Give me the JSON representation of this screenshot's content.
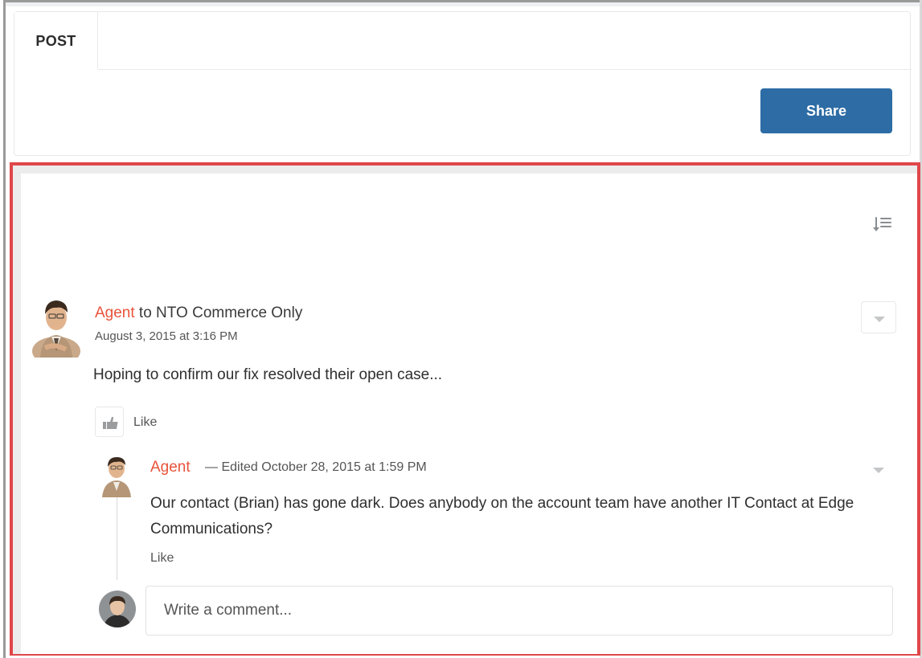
{
  "publisher": {
    "tab_label": "POST",
    "share_label": "Share"
  },
  "feed": {
    "sort_icon": "sort-icon",
    "post": {
      "author": "Agent",
      "to_text": " to NTO Commerce Only",
      "date": "August 3, 2015 at 3:16 PM",
      "body": "Hoping to confirm our fix resolved their open case...",
      "like_label": "Like",
      "menu_icon": "chevron-down-icon"
    },
    "comment": {
      "author": "Agent",
      "meta": "— Edited October 28, 2015 at 1:59 PM",
      "body": "Our contact (Brian) has gone dark. Does anybody on the account team have another IT Contact at Edge Communications?",
      "like_label": "Like"
    },
    "new_comment": {
      "placeholder": "Write a comment..."
    }
  },
  "colors": {
    "accent_orange": "#e8533a",
    "share_blue": "#2d6ca5",
    "highlight_red": "#e0474a"
  }
}
